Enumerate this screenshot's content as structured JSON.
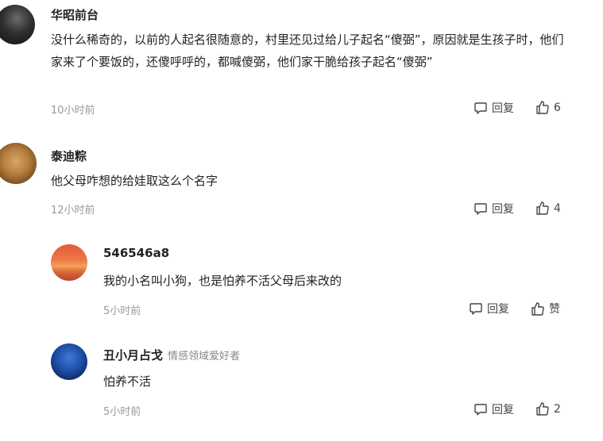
{
  "comments": [
    {
      "username": "华昭前台",
      "text": "没什么稀奇的，以前的人起名很随意的，村里还见过给儿子起名“傻弼”，原因就是生孩子时，他们家来了个要饭的，还傻呼呼的，都喊傻弼，他们家干脆给孩子起名“傻弼”",
      "time": "10小时前",
      "reply_label": "回复",
      "like_count": "6"
    },
    {
      "username": "泰迪粽",
      "text": "他父母咋想的给娃取这么个名字",
      "time": "12小时前",
      "reply_label": "回复",
      "like_count": "4"
    },
    {
      "username": "546546a8",
      "text": "我的小名叫小狗，也是怕养不活父母后来改的",
      "time": "5小时前",
      "reply_label": "回复",
      "like_count": "赞"
    },
    {
      "username": "丑小月占戈",
      "tag": "情感领域爱好者",
      "text": "怕养不活",
      "time": "5小时前",
      "reply_label": "回复",
      "like_count": "2"
    }
  ],
  "icons": {
    "reply": "comment-bubble-icon",
    "like": "thumbs-up-icon"
  }
}
